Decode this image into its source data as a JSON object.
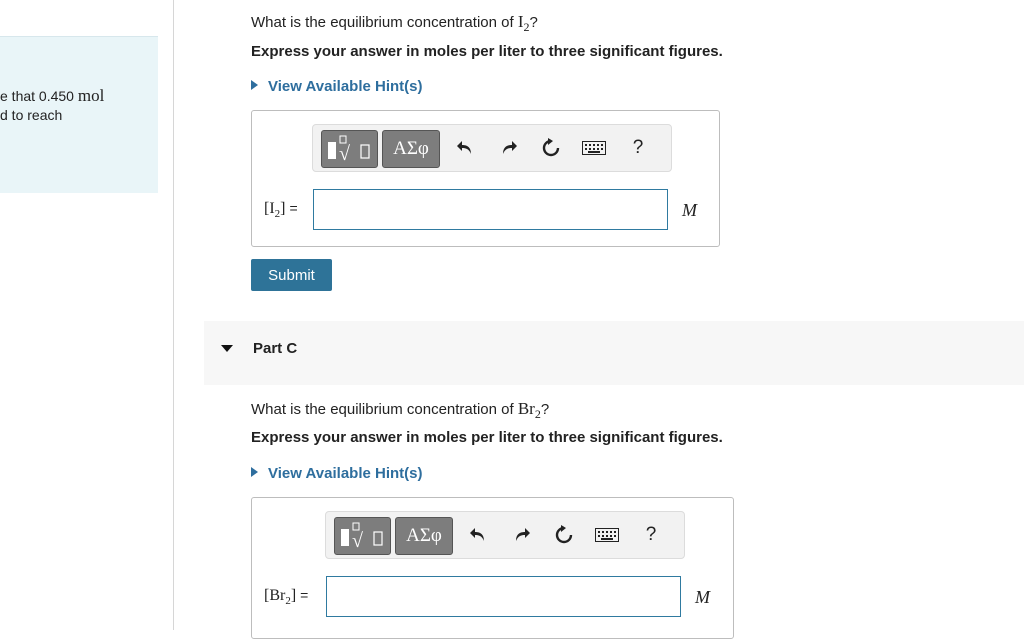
{
  "left": {
    "line1_pre": "e that 0.450 ",
    "line1_unit": "mol",
    "line2": "d to reach"
  },
  "part_b": {
    "question_pre": "What is the equilibrium concentration of ",
    "question_species": "I",
    "question_sub": "2",
    "question_post": "?",
    "instruction": "Express your answer in moles per liter to three significant figures.",
    "hint": "View Available Hint(s)",
    "label_species": "I",
    "label_sub": "2",
    "unit": "M",
    "input_value": "",
    "submit": "Submit"
  },
  "part_c": {
    "title": "Part C",
    "question_pre": "What is the equilibrium concentration of ",
    "question_species": "Br",
    "question_sub": "2",
    "question_post": "?",
    "instruction": "Express your answer in moles per liter to three significant figures.",
    "hint": "View Available Hint(s)",
    "label_species": "Br",
    "label_sub": "2",
    "unit": "M",
    "input_value": ""
  },
  "toolbar": {
    "greek": "ΑΣφ",
    "help": "?"
  }
}
